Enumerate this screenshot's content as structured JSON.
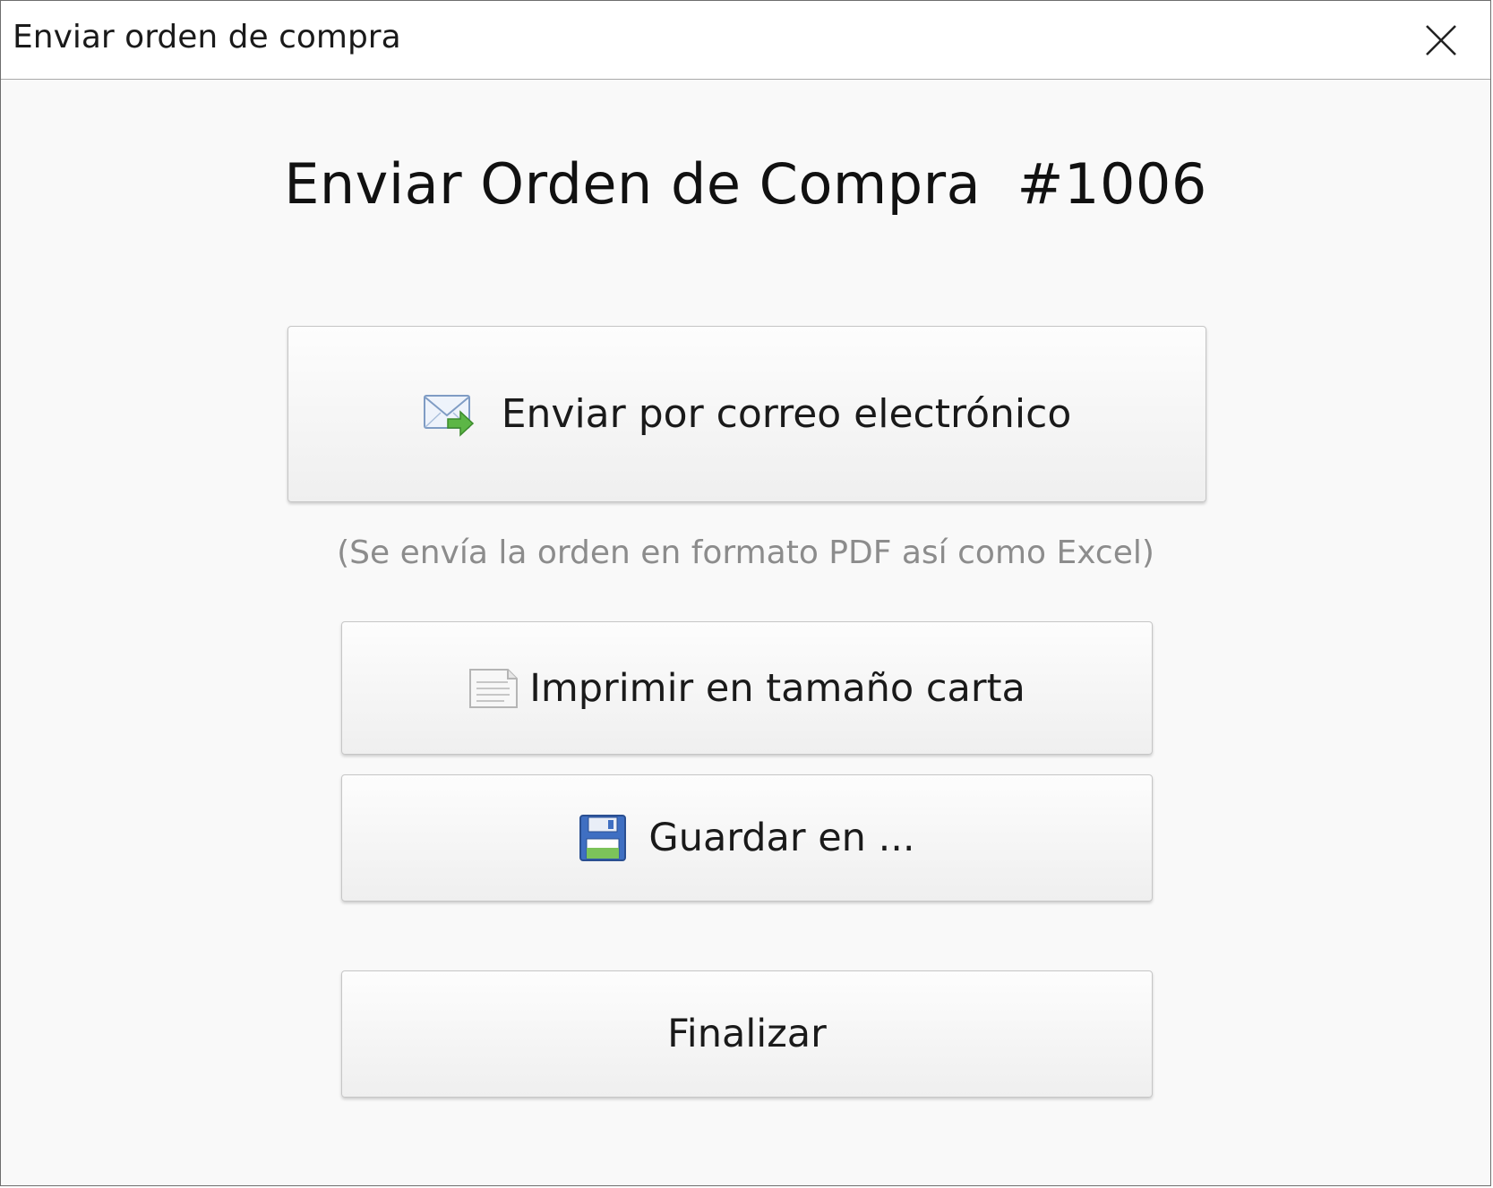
{
  "window": {
    "title": "Enviar orden de compra",
    "close_icon": "close-icon"
  },
  "main": {
    "heading": "Enviar Orden de Compra  #1006",
    "email_button": {
      "label": "Enviar por correo electrónico",
      "icon": "email-send-icon"
    },
    "email_note": "(Se envía la orden en formato PDF así como Excel)",
    "print_button": {
      "label": "Imprimir en tamaño carta",
      "icon": "document-icon"
    },
    "save_button": {
      "label": "Guardar en ...",
      "icon": "floppy-disk-icon"
    },
    "finish_button": {
      "label": "Finalizar"
    }
  },
  "colors": {
    "window_bg": "#f9f9f9",
    "titlebar_bg": "#ffffff",
    "note_text": "#8c8c8c"
  }
}
